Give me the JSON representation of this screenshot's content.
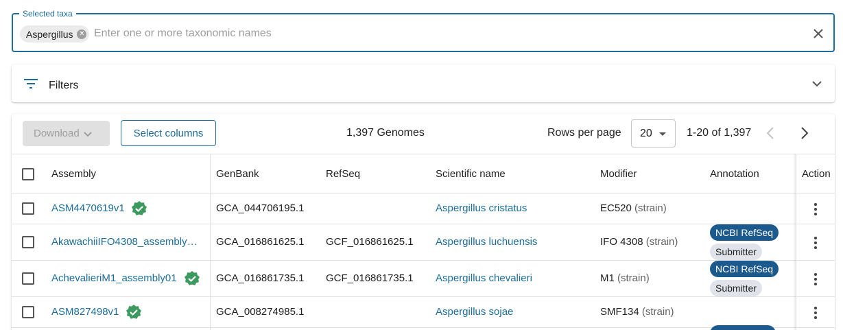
{
  "taxa": {
    "legend": "Selected taxa",
    "chip_label": "Aspergillus",
    "placeholder": "Enter one or more taxonomic names"
  },
  "filters": {
    "label": "Filters"
  },
  "toolbar": {
    "download_label": "Download",
    "select_columns_label": "Select columns",
    "count_label": "1,397 Genomes",
    "rows_per_page_label": "Rows per page",
    "rows_per_page_value": "20",
    "range_label": "1-20 of 1,397"
  },
  "columns": {
    "assembly": "Assembly",
    "genbank": "GenBank",
    "refseq": "RefSeq",
    "scientific_name": "Scientific name",
    "modifier": "Modifier",
    "annotation": "Annotation",
    "action": "Action"
  },
  "rows": [
    {
      "assembly": "ASM4470619v1",
      "verified": true,
      "genbank": "GCA_044706195.1",
      "refseq": "",
      "scientific_name": "Aspergillus cristatus",
      "modifier_value": "EC520",
      "modifier_type": "(strain)",
      "annotations": []
    },
    {
      "assembly": "AkawachiiIFO4308_assembly0...",
      "verified": false,
      "genbank": "GCA_016861625.1",
      "refseq": "GCF_016861625.1",
      "scientific_name": "Aspergillus luchuensis",
      "modifier_value": "IFO 4308",
      "modifier_type": "(strain)",
      "annotations": [
        "NCBI RefSeq",
        "Submitter"
      ]
    },
    {
      "assembly": "AchevalieriM1_assembly01",
      "verified": true,
      "genbank": "GCA_016861735.1",
      "refseq": "GCF_016861735.1",
      "scientific_name": "Aspergillus chevalieri",
      "modifier_value": "M1",
      "modifier_type": "(strain)",
      "annotations": [
        "NCBI RefSeq",
        "Submitter"
      ]
    },
    {
      "assembly": "ASM827498v1",
      "verified": true,
      "genbank": "GCA_008274985.1",
      "refseq": "",
      "scientific_name": "Aspergillus sojae",
      "modifier_value": "SMF134",
      "modifier_type": "(strain)",
      "annotations": []
    }
  ],
  "colors": {
    "accent": "#1c6d9b",
    "refseq_pill": "#1c5a8d",
    "verified_badge": "#3c9a5f"
  }
}
